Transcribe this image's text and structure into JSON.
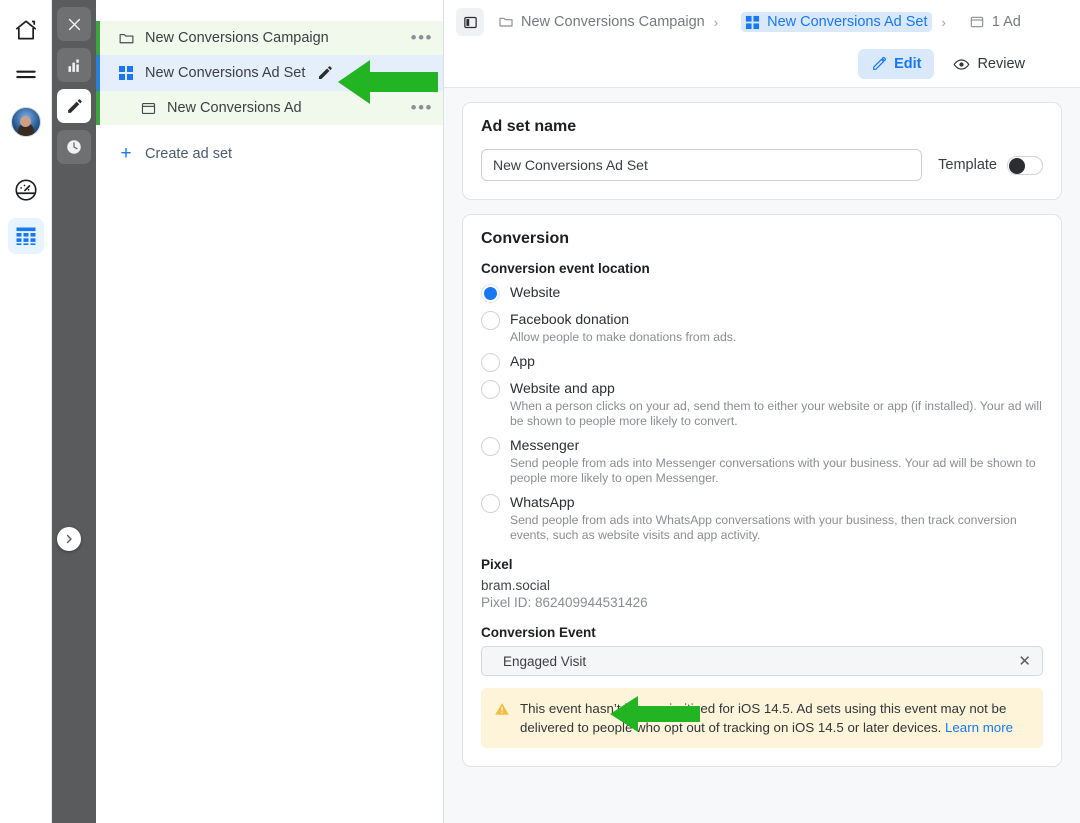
{
  "left_rail": {
    "items": [
      {
        "name": "home-icon",
        "label": "Home"
      },
      {
        "name": "menu-icon",
        "label": "Menu"
      },
      {
        "name": "avatar",
        "label": "Account"
      },
      {
        "name": "dashboard-icon",
        "label": "Dashboard"
      },
      {
        "name": "grid-table-icon",
        "label": "Ads Manager"
      }
    ]
  },
  "dark_rail": {
    "items": [
      {
        "name": "close-icon",
        "label": "Close"
      },
      {
        "name": "chart-bar-icon",
        "label": "Analytics"
      },
      {
        "name": "pencil-icon",
        "label": "Edit"
      },
      {
        "name": "clock-icon",
        "label": "History"
      }
    ],
    "expand_label": "Expand"
  },
  "tree": {
    "campaign": {
      "label": "New Conversions Campaign",
      "menu": "•••"
    },
    "adset": {
      "label": "New Conversions Ad Set"
    },
    "ad": {
      "label": "New Conversions Ad",
      "menu": "•••"
    },
    "create": {
      "plus": "+",
      "label": "Create ad set"
    }
  },
  "breadcrumb": {
    "campaign": "New Conversions Campaign",
    "adset": "New Conversions Ad Set",
    "ad": "1 Ad",
    "separator": "›"
  },
  "actions": {
    "edit_label": "Edit",
    "review_label": "Review"
  },
  "ad_set_name": {
    "heading": "Ad set name",
    "value": "New Conversions Ad Set",
    "placeholder": "Ad set name",
    "template_label": "Template"
  },
  "conversion": {
    "heading": "Conversion",
    "event_location_label": "Conversion event location",
    "options": [
      {
        "title": "Website",
        "desc": "",
        "selected": true
      },
      {
        "title": "Facebook donation",
        "desc": "Allow people to make donations from ads.",
        "selected": false
      },
      {
        "title": "App",
        "desc": "",
        "selected": false
      },
      {
        "title": "Website and app",
        "desc": "When a person clicks on your ad, send them to either your website or app (if installed). Your ad will be shown to people more likely to convert.",
        "selected": false
      },
      {
        "title": "Messenger",
        "desc": "Send people from ads into Messenger conversations with your business. Your ad will be shown to people more likely to open Messenger.",
        "selected": false
      },
      {
        "title": "WhatsApp",
        "desc": "Send people from ads into WhatsApp conversations with your business, then track conversion events, such as website visits and app activity.",
        "selected": false
      }
    ],
    "pixel_heading": "Pixel",
    "pixel_name": "bram.social",
    "pixel_id": "Pixel ID: 862409944531426",
    "conversion_event_heading": "Conversion Event",
    "conversion_event_value": "Engaged Visit",
    "clear_icon": "✕",
    "warning_text": "This event hasn’t been prioritized for iOS 14.5. Ad sets using this event may not be delivered to people who opt out of tracking on iOS 14.5 or later devices. ",
    "warning_link": "Learn more"
  },
  "colors": {
    "accent_blue": "#1877f2",
    "annotation_green": "#22b422",
    "campaign_green": "#3fa33f",
    "warning_bg": "#fdf4da"
  }
}
